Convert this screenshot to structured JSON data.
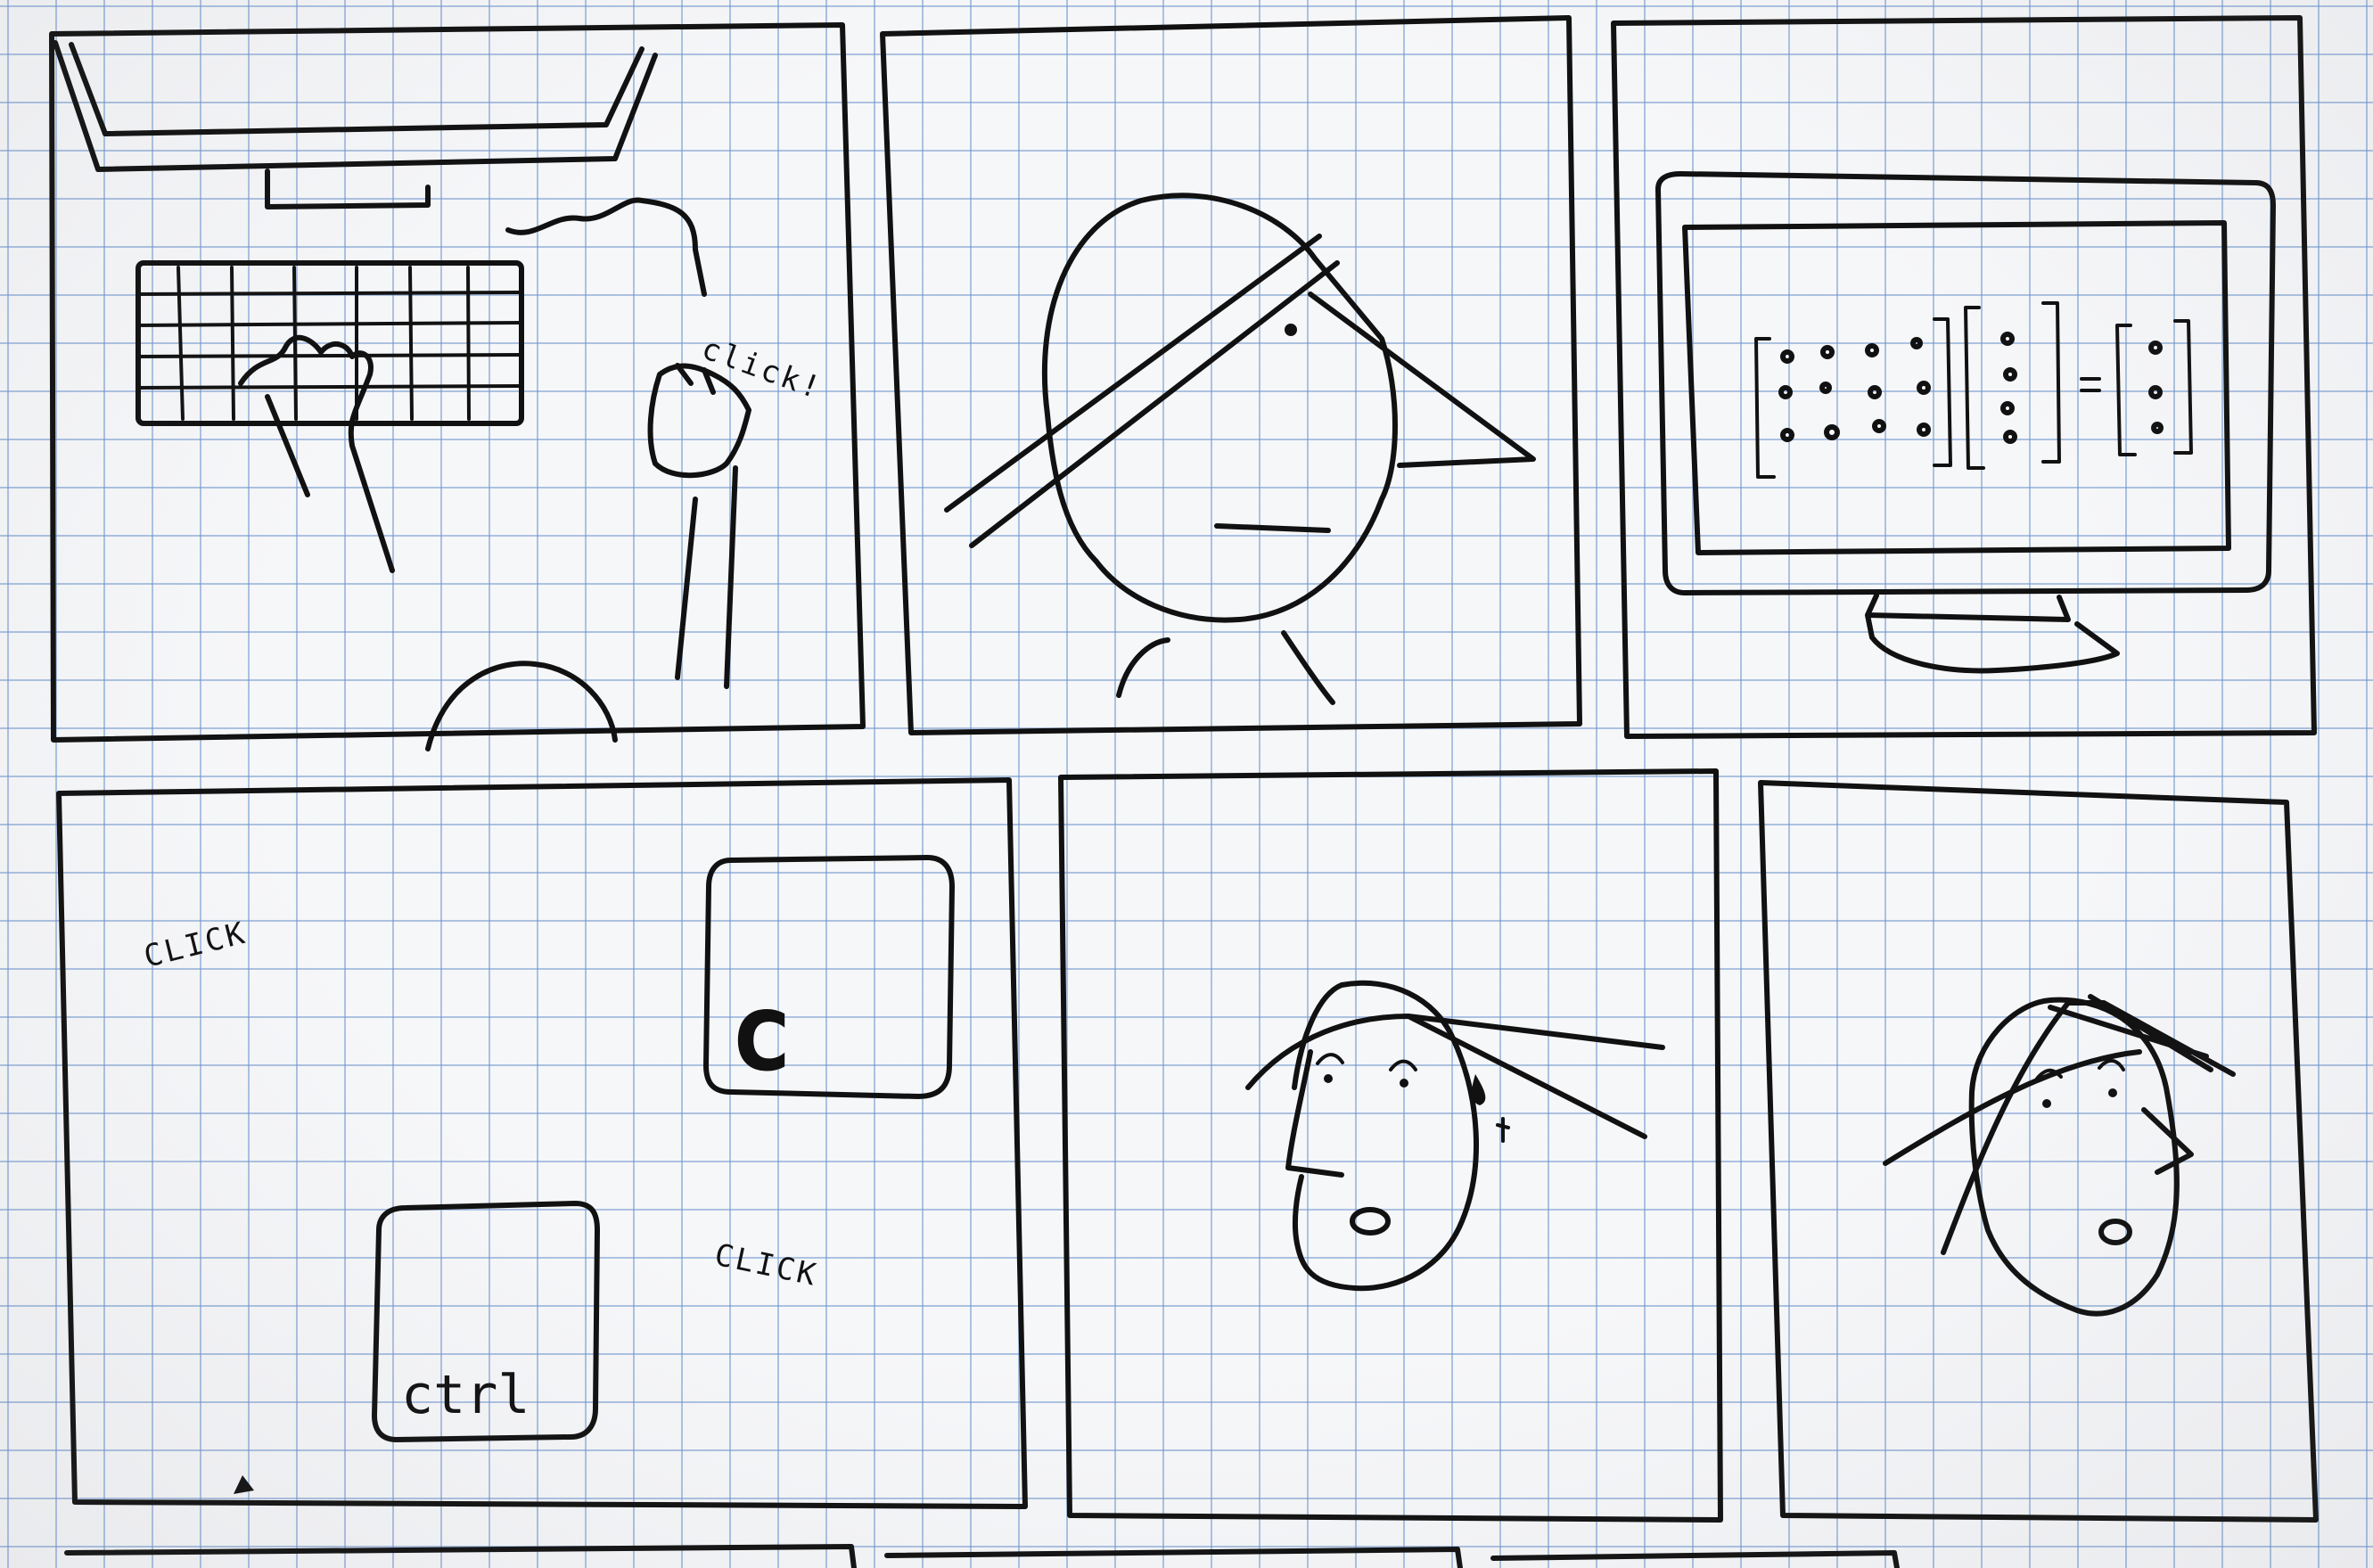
{
  "panels": {
    "p1": {
      "sfx": "click!"
    },
    "p4": {
      "sfx_top": "CLICK",
      "sfx_bottom": "CLICK",
      "key_c": "c",
      "key_ctrl": "ctrl"
    }
  }
}
